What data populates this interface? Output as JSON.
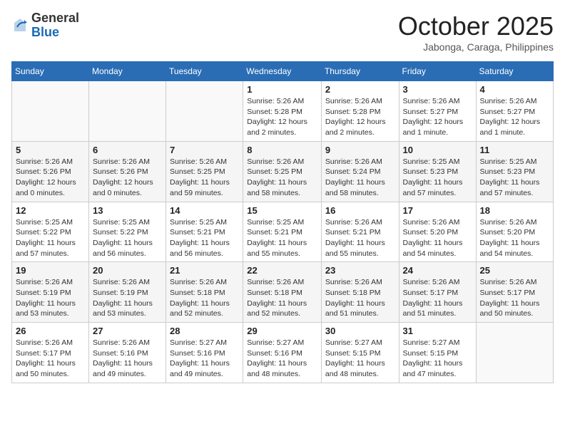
{
  "logo": {
    "general": "General",
    "blue": "Blue"
  },
  "title": "October 2025",
  "location": "Jabonga, Caraga, Philippines",
  "weekdays": [
    "Sunday",
    "Monday",
    "Tuesday",
    "Wednesday",
    "Thursday",
    "Friday",
    "Saturday"
  ],
  "weeks": [
    [
      {
        "day": "",
        "sunrise": "",
        "sunset": "",
        "daylight": ""
      },
      {
        "day": "",
        "sunrise": "",
        "sunset": "",
        "daylight": ""
      },
      {
        "day": "",
        "sunrise": "",
        "sunset": "",
        "daylight": ""
      },
      {
        "day": "1",
        "sunrise": "Sunrise: 5:26 AM",
        "sunset": "Sunset: 5:28 PM",
        "daylight": "Daylight: 12 hours and 2 minutes."
      },
      {
        "day": "2",
        "sunrise": "Sunrise: 5:26 AM",
        "sunset": "Sunset: 5:28 PM",
        "daylight": "Daylight: 12 hours and 2 minutes."
      },
      {
        "day": "3",
        "sunrise": "Sunrise: 5:26 AM",
        "sunset": "Sunset: 5:27 PM",
        "daylight": "Daylight: 12 hours and 1 minute."
      },
      {
        "day": "4",
        "sunrise": "Sunrise: 5:26 AM",
        "sunset": "Sunset: 5:27 PM",
        "daylight": "Daylight: 12 hours and 1 minute."
      }
    ],
    [
      {
        "day": "5",
        "sunrise": "Sunrise: 5:26 AM",
        "sunset": "Sunset: 5:26 PM",
        "daylight": "Daylight: 12 hours and 0 minutes."
      },
      {
        "day": "6",
        "sunrise": "Sunrise: 5:26 AM",
        "sunset": "Sunset: 5:26 PM",
        "daylight": "Daylight: 12 hours and 0 minutes."
      },
      {
        "day": "7",
        "sunrise": "Sunrise: 5:26 AM",
        "sunset": "Sunset: 5:25 PM",
        "daylight": "Daylight: 11 hours and 59 minutes."
      },
      {
        "day": "8",
        "sunrise": "Sunrise: 5:26 AM",
        "sunset": "Sunset: 5:25 PM",
        "daylight": "Daylight: 11 hours and 58 minutes."
      },
      {
        "day": "9",
        "sunrise": "Sunrise: 5:26 AM",
        "sunset": "Sunset: 5:24 PM",
        "daylight": "Daylight: 11 hours and 58 minutes."
      },
      {
        "day": "10",
        "sunrise": "Sunrise: 5:25 AM",
        "sunset": "Sunset: 5:23 PM",
        "daylight": "Daylight: 11 hours and 57 minutes."
      },
      {
        "day": "11",
        "sunrise": "Sunrise: 5:25 AM",
        "sunset": "Sunset: 5:23 PM",
        "daylight": "Daylight: 11 hours and 57 minutes."
      }
    ],
    [
      {
        "day": "12",
        "sunrise": "Sunrise: 5:25 AM",
        "sunset": "Sunset: 5:22 PM",
        "daylight": "Daylight: 11 hours and 57 minutes."
      },
      {
        "day": "13",
        "sunrise": "Sunrise: 5:25 AM",
        "sunset": "Sunset: 5:22 PM",
        "daylight": "Daylight: 11 hours and 56 minutes."
      },
      {
        "day": "14",
        "sunrise": "Sunrise: 5:25 AM",
        "sunset": "Sunset: 5:21 PM",
        "daylight": "Daylight: 11 hours and 56 minutes."
      },
      {
        "day": "15",
        "sunrise": "Sunrise: 5:25 AM",
        "sunset": "Sunset: 5:21 PM",
        "daylight": "Daylight: 11 hours and 55 minutes."
      },
      {
        "day": "16",
        "sunrise": "Sunrise: 5:26 AM",
        "sunset": "Sunset: 5:21 PM",
        "daylight": "Daylight: 11 hours and 55 minutes."
      },
      {
        "day": "17",
        "sunrise": "Sunrise: 5:26 AM",
        "sunset": "Sunset: 5:20 PM",
        "daylight": "Daylight: 11 hours and 54 minutes."
      },
      {
        "day": "18",
        "sunrise": "Sunrise: 5:26 AM",
        "sunset": "Sunset: 5:20 PM",
        "daylight": "Daylight: 11 hours and 54 minutes."
      }
    ],
    [
      {
        "day": "19",
        "sunrise": "Sunrise: 5:26 AM",
        "sunset": "Sunset: 5:19 PM",
        "daylight": "Daylight: 11 hours and 53 minutes."
      },
      {
        "day": "20",
        "sunrise": "Sunrise: 5:26 AM",
        "sunset": "Sunset: 5:19 PM",
        "daylight": "Daylight: 11 hours and 53 minutes."
      },
      {
        "day": "21",
        "sunrise": "Sunrise: 5:26 AM",
        "sunset": "Sunset: 5:18 PM",
        "daylight": "Daylight: 11 hours and 52 minutes."
      },
      {
        "day": "22",
        "sunrise": "Sunrise: 5:26 AM",
        "sunset": "Sunset: 5:18 PM",
        "daylight": "Daylight: 11 hours and 52 minutes."
      },
      {
        "day": "23",
        "sunrise": "Sunrise: 5:26 AM",
        "sunset": "Sunset: 5:18 PM",
        "daylight": "Daylight: 11 hours and 51 minutes."
      },
      {
        "day": "24",
        "sunrise": "Sunrise: 5:26 AM",
        "sunset": "Sunset: 5:17 PM",
        "daylight": "Daylight: 11 hours and 51 minutes."
      },
      {
        "day": "25",
        "sunrise": "Sunrise: 5:26 AM",
        "sunset": "Sunset: 5:17 PM",
        "daylight": "Daylight: 11 hours and 50 minutes."
      }
    ],
    [
      {
        "day": "26",
        "sunrise": "Sunrise: 5:26 AM",
        "sunset": "Sunset: 5:17 PM",
        "daylight": "Daylight: 11 hours and 50 minutes."
      },
      {
        "day": "27",
        "sunrise": "Sunrise: 5:26 AM",
        "sunset": "Sunset: 5:16 PM",
        "daylight": "Daylight: 11 hours and 49 minutes."
      },
      {
        "day": "28",
        "sunrise": "Sunrise: 5:27 AM",
        "sunset": "Sunset: 5:16 PM",
        "daylight": "Daylight: 11 hours and 49 minutes."
      },
      {
        "day": "29",
        "sunrise": "Sunrise: 5:27 AM",
        "sunset": "Sunset: 5:16 PM",
        "daylight": "Daylight: 11 hours and 48 minutes."
      },
      {
        "day": "30",
        "sunrise": "Sunrise: 5:27 AM",
        "sunset": "Sunset: 5:15 PM",
        "daylight": "Daylight: 11 hours and 48 minutes."
      },
      {
        "day": "31",
        "sunrise": "Sunrise: 5:27 AM",
        "sunset": "Sunset: 5:15 PM",
        "daylight": "Daylight: 11 hours and 47 minutes."
      },
      {
        "day": "",
        "sunrise": "",
        "sunset": "",
        "daylight": ""
      }
    ]
  ]
}
